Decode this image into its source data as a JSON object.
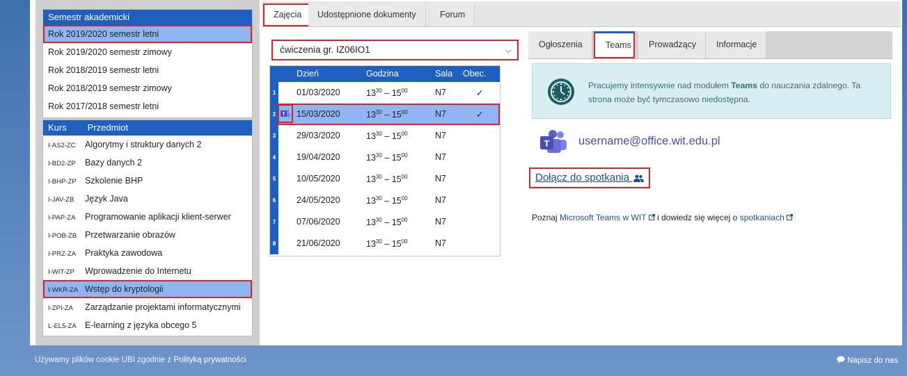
{
  "semesters": {
    "header": "Semestr akademicki",
    "items": [
      {
        "label": "Rok 2019/2020 semestr letni",
        "selected": true
      },
      {
        "label": "Rok 2019/2020 semestr zimowy",
        "selected": false
      },
      {
        "label": "Rok 2018/2019 semestr letni",
        "selected": false
      },
      {
        "label": "Rok 2018/2019 semestr zimowy",
        "selected": false
      },
      {
        "label": "Rok 2017/2018 semestr letni",
        "selected": false
      }
    ]
  },
  "courses": {
    "header_code": "Kurs",
    "header_name": "Przedmiot",
    "items": [
      {
        "code": "I-AS2-ZC",
        "name": "Algorytmy i struktury danych 2"
      },
      {
        "code": "I-BD2-ZP",
        "name": "Bazy danych 2"
      },
      {
        "code": "I-BHP-ZP",
        "name": "Szkolenie BHP"
      },
      {
        "code": "I-JAV-ZB",
        "name": "Język Java"
      },
      {
        "code": "I-PAP-ZA",
        "name": "Programowanie aplikacji klient-serwer"
      },
      {
        "code": "I-POB-ZB",
        "name": "Przetwarzanie obrazów"
      },
      {
        "code": "I-PRZ-ZA",
        "name": "Praktyka zawodowa"
      },
      {
        "code": "I-WIT-ZP",
        "name": "Wprowadzenie do Internetu"
      },
      {
        "code": "I-WKR-ZA",
        "name": "Wstęp do kryptologii"
      },
      {
        "code": "I-ZPI-ZA",
        "name": "Zarządzanie projektami informatycznymi"
      },
      {
        "code": "L-EL5-ZA",
        "name": "E-learning z języka obcego 5"
      }
    ]
  },
  "main_tabs": {
    "zajecia": "Zajęcia",
    "dokumenty": "Udostępnione dokumenty",
    "forum": "Forum"
  },
  "group_select": {
    "value": "ćwiczenia gr. IZ06IO1",
    "chevron": "⌵"
  },
  "schedule": {
    "headers": {
      "day": "Dzień",
      "time": "Godzina",
      "room": "Sala",
      "present": "Obec."
    },
    "time_start": "13",
    "time_start_min": "30",
    "time_sep": " – ",
    "time_end": "15",
    "time_end_min": "00",
    "rows": [
      {
        "n": "1",
        "date": "01/03/2020",
        "room": "N7",
        "present": "✓"
      },
      {
        "n": "2",
        "date": "15/03/2020",
        "room": "N7",
        "present": "✓"
      },
      {
        "n": "3",
        "date": "29/03/2020",
        "room": "N7",
        "present": ""
      },
      {
        "n": "4",
        "date": "19/04/2020",
        "room": "N7",
        "present": ""
      },
      {
        "n": "5",
        "date": "10/05/2020",
        "room": "N7",
        "present": ""
      },
      {
        "n": "6",
        "date": "24/05/2020",
        "room": "N7",
        "present": ""
      },
      {
        "n": "7",
        "date": "07/06/2020",
        "room": "N7",
        "present": ""
      },
      {
        "n": "8",
        "date": "21/06/2020",
        "room": "N7",
        "present": ""
      }
    ],
    "selected_row": 1
  },
  "right_tabs": {
    "ogloszenia": "Ogłoszenia",
    "teams": "Teams",
    "prowadzacy": "Prowadzący",
    "informacje": "Informacje"
  },
  "notice": {
    "before": "Pracujemy intensywnie nad modułem ",
    "bold": "Teams",
    "after": " do nauczania zdalnego. Ta strona może być tymczasowo niedostępna."
  },
  "teams_user": "username@office.wit.edu.pl",
  "join_meeting": "Dołącz do spotkania",
  "info": {
    "t1": "Poznaj ",
    "link1": "Microsoft Teams w WIT",
    "t2": " i dowiedz się więcej o ",
    "link2": "spotkaniach"
  },
  "footer": {
    "cookie_text": "Używamy plików cookie UBI zgodnie z ",
    "cookie_link": "Polityką prywatności",
    "chat": "Napisz do nas"
  },
  "colors": {
    "accent_blue": "#1f5fbf",
    "selection": "#8fb6f2",
    "highlight_red": "#d9232a",
    "teams_purple": "#5b5fc7"
  }
}
